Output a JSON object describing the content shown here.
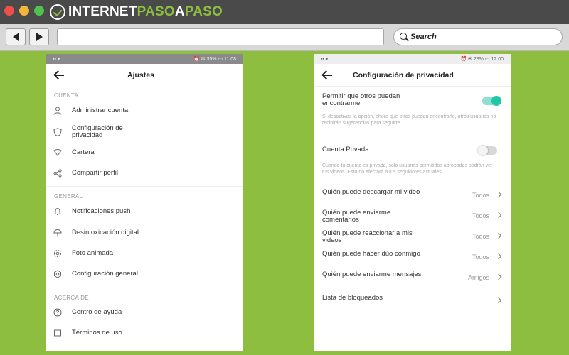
{
  "browser": {
    "logo_part1": "INTERNET",
    "logo_part2": "PASO",
    "logo_part3": "A",
    "logo_part4": "PASO",
    "search_placeholder": "Search"
  },
  "left_screen": {
    "status_left": "▪▪ ▾",
    "status_right": "⏰ ✉ 35% ▭ 11:08",
    "title": "Ajustes",
    "sections": [
      {
        "label": "CUENTA",
        "items": [
          {
            "label": "Administrar cuenta",
            "icon": "person-icon"
          },
          {
            "label": "Configuración de privacidad",
            "icon": "shield-icon"
          },
          {
            "label": "Cartera",
            "icon": "wallet-icon"
          },
          {
            "label": "Compartir perfil",
            "icon": "share-icon"
          }
        ]
      },
      {
        "label": "GENERAL",
        "items": [
          {
            "label": "Notificaciones push",
            "icon": "bell-icon"
          },
          {
            "label": "Desintoxicación digital",
            "icon": "umbrella-icon"
          },
          {
            "label": "Foto animada",
            "icon": "gear-icon"
          },
          {
            "label": "Configuración general",
            "icon": "settings-icon"
          }
        ]
      },
      {
        "label": "ACERCA DE",
        "items": [
          {
            "label": "Centro de ayuda",
            "icon": "help-icon"
          },
          {
            "label": "Términos de uso",
            "icon": "document-icon"
          }
        ]
      }
    ]
  },
  "right_screen": {
    "status_left": "▪▪ ▾",
    "status_right": "⏰ ✉ 29% ▭ 12:00",
    "title": "Configuración de privacidad",
    "find_me_label": "Permitir que otros puedan encontrarme",
    "find_me_enabled": true,
    "find_me_desc": "Si desactivas la opción, ahora que otros puedan encontrarte, otros usuarios no recibirán sugerencias para seguirte.",
    "private_label": "Cuenta Privada",
    "private_enabled": false,
    "private_desc": "Cuando tu cuenta es privada, solo usuarios permitidos aprobados podrán ver tus videos. Esto no afectará a tus seguidores actuales.",
    "options": [
      {
        "label": "Quién puede descargar mi video",
        "value": "Todos"
      },
      {
        "label": "Quién puede enviarme comentarios",
        "value": "Todos"
      },
      {
        "label": "Quién puede reaccionar a mis videos",
        "value": "Todos"
      },
      {
        "label": "Quién puede hacer dúo conmigo",
        "value": "Todos"
      },
      {
        "label": "Quién puede enviarme mensajes",
        "value": "Amigos"
      },
      {
        "label": "Lista de bloqueados",
        "value": ""
      }
    ],
    "accent_color": "#20c8a8"
  }
}
